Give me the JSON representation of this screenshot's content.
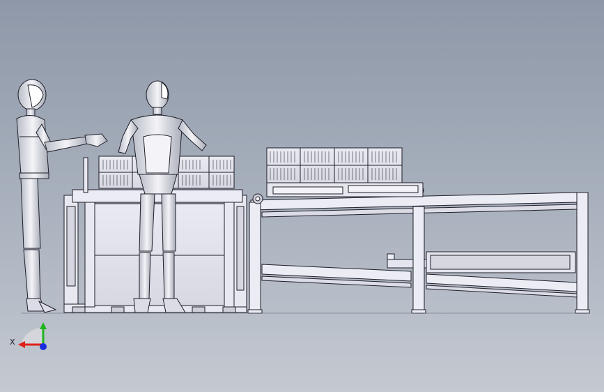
{
  "viewport": {
    "background_top": "#8e98a8",
    "background_bottom": "#c4c9d1"
  },
  "triad": {
    "x_label": "X",
    "x_color": "#e0201a",
    "y_color": "#1fb41f",
    "z_color": "#1a2ee0"
  },
  "scene": {
    "figures": [
      "humanoid-robot",
      "humanoid-robot"
    ],
    "equipment": [
      "cell-station",
      "conveyor-line"
    ]
  }
}
